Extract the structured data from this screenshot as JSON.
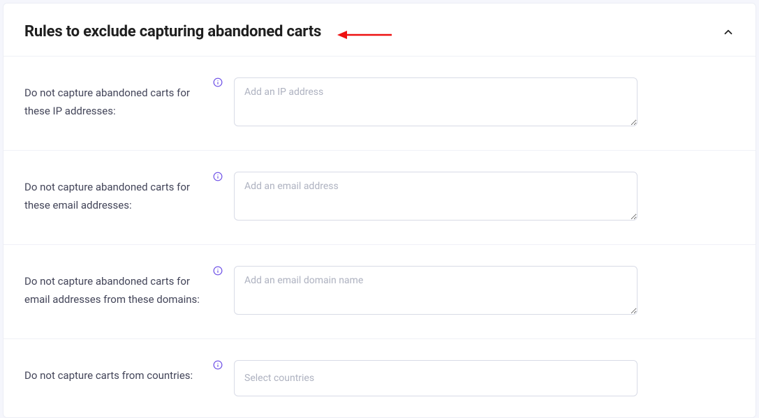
{
  "header": {
    "title": "Rules to exclude capturing abandoned carts"
  },
  "rows": {
    "ip": {
      "label": "Do not capture abandoned carts for these IP addresses:",
      "placeholder": "Add an IP address"
    },
    "email": {
      "label": "Do not capture abandoned carts for these email addresses:",
      "placeholder": "Add an email address"
    },
    "domain": {
      "label": "Do not capture abandoned carts for email addresses from these domains:",
      "placeholder": "Add an email domain name"
    },
    "country": {
      "label": "Do not capture carts from countries:",
      "placeholder": "Select countries"
    }
  }
}
